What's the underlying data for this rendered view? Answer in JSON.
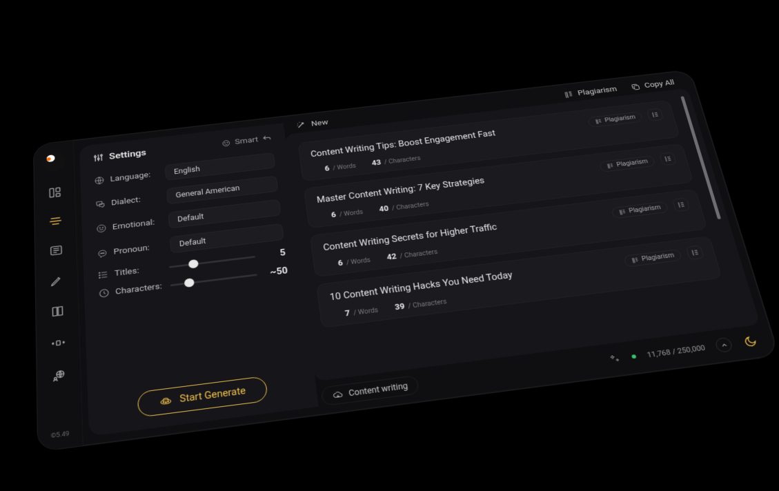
{
  "version": "©5.49",
  "panel": {
    "tab_settings": "Settings",
    "tab_smart": "Smart",
    "language_label": "Language:",
    "language_value": "English",
    "dialect_label": "Dialect:",
    "dialect_value": "General American",
    "emotional_label": "Emotional:",
    "emotional_value": "Default",
    "pronoun_label": "Pronoun:",
    "pronoun_value": "Default",
    "titles_label": "Titles:",
    "titles_value": "5",
    "characters_label": "Characters:",
    "characters_value": "~50",
    "generate_label": "Start Generate"
  },
  "top": {
    "new": "New",
    "plagiarism": "Plagiarism",
    "copy_all": "Copy All"
  },
  "cards": [
    {
      "title": "Content Writing Tips: Boost Engagement Fast",
      "words": "6",
      "words_label": "/ Words",
      "chars": "43",
      "chars_label": "/ Characters",
      "chip": "Plagiarism"
    },
    {
      "title": "Master Content Writing: 7 Key Strategies",
      "words": "6",
      "words_label": "/ Words",
      "chars": "40",
      "chars_label": "/ Characters",
      "chip": "Plagiarism"
    },
    {
      "title": "Content Writing Secrets for Higher Traffic",
      "words": "6",
      "words_label": "/ Words",
      "chars": "42",
      "chars_label": "/ Characters",
      "chip": "Plagiarism"
    },
    {
      "title": "10 Content Writing Hacks You Need Today",
      "words": "7",
      "words_label": "/ Words",
      "chars": "39",
      "chars_label": "/ Characters",
      "chip": "Plagiarism"
    }
  ],
  "footer": {
    "tag": "Content writing",
    "credits_used": "11,768",
    "credits_sep": " / ",
    "credits_total": "250,000"
  }
}
